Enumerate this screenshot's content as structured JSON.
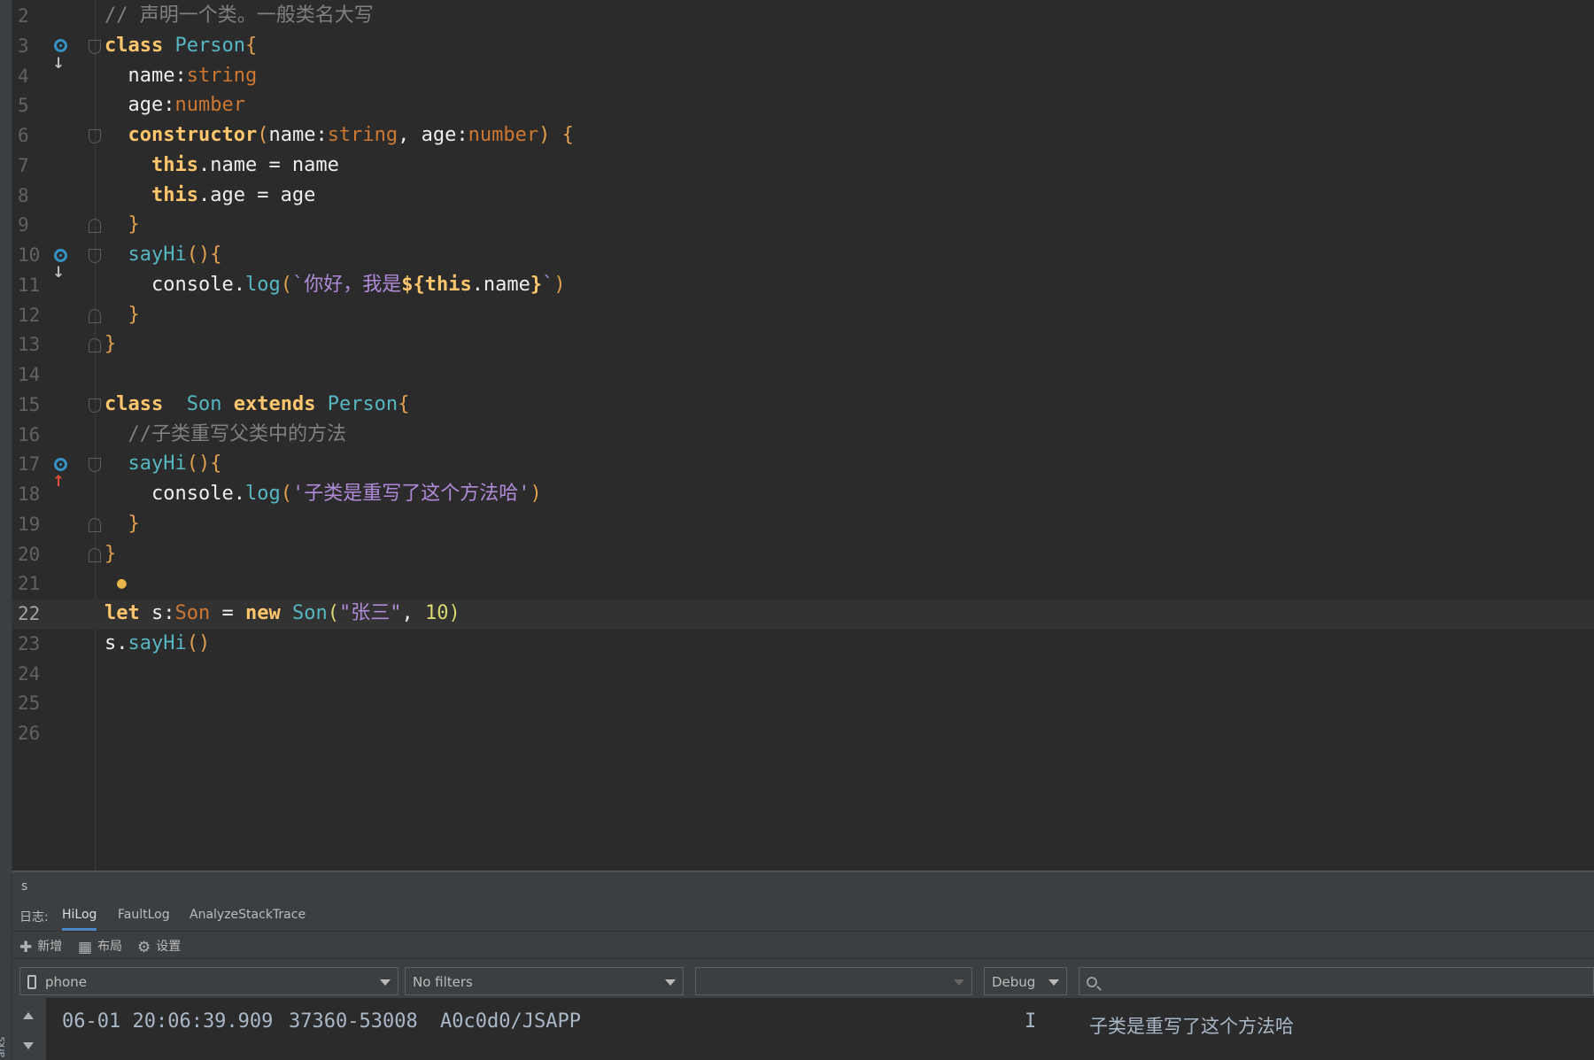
{
  "left_strip": {
    "label": "arks"
  },
  "editor": {
    "lines": [
      {
        "n": "2",
        "tokens": [
          {
            "t": "// 声明一个类。一般类名大写",
            "c": "cm"
          }
        ]
      },
      {
        "n": "3",
        "marker": "down",
        "fold": "open",
        "tokens": [
          {
            "t": "class",
            "c": "kwb"
          },
          {
            "t": " ",
            "c": "id"
          },
          {
            "t": "Person",
            "c": "cls"
          },
          {
            "t": "{",
            "c": "br"
          }
        ]
      },
      {
        "n": "4",
        "tokens": [
          {
            "t": "  name",
            "c": "id"
          },
          {
            "t": ":",
            "c": "id"
          },
          {
            "t": "string",
            "c": "typ"
          }
        ]
      },
      {
        "n": "5",
        "tokens": [
          {
            "t": "  age",
            "c": "id"
          },
          {
            "t": ":",
            "c": "id"
          },
          {
            "t": "number",
            "c": "typ"
          }
        ]
      },
      {
        "n": "6",
        "fold": "open",
        "tokens": [
          {
            "t": "  ",
            "c": "id"
          },
          {
            "t": "constructor",
            "c": "ctor"
          },
          {
            "t": "(",
            "c": "br"
          },
          {
            "t": "name",
            "c": "id"
          },
          {
            "t": ":",
            "c": "id"
          },
          {
            "t": "string",
            "c": "typ"
          },
          {
            "t": ", ",
            "c": "id"
          },
          {
            "t": "age",
            "c": "id"
          },
          {
            "t": ":",
            "c": "id"
          },
          {
            "t": "number",
            "c": "typ"
          },
          {
            "t": ")",
            "c": "br"
          },
          {
            "t": " ",
            "c": "id"
          },
          {
            "t": "{",
            "c": "br"
          }
        ]
      },
      {
        "n": "7",
        "tokens": [
          {
            "t": "    ",
            "c": "id"
          },
          {
            "t": "this",
            "c": "this"
          },
          {
            "t": ".name = name",
            "c": "id"
          }
        ]
      },
      {
        "n": "8",
        "tokens": [
          {
            "t": "    ",
            "c": "id"
          },
          {
            "t": "this",
            "c": "this"
          },
          {
            "t": ".age = age",
            "c": "id"
          }
        ]
      },
      {
        "n": "9",
        "fold": "close",
        "tokens": [
          {
            "t": "  ",
            "c": "id"
          },
          {
            "t": "}",
            "c": "br"
          }
        ]
      },
      {
        "n": "10",
        "marker": "down",
        "fold": "open",
        "tokens": [
          {
            "t": "  ",
            "c": "id"
          },
          {
            "t": "sayHi",
            "c": "fn"
          },
          {
            "t": "(){",
            "c": "br"
          }
        ]
      },
      {
        "n": "11",
        "tokens": [
          {
            "t": "    console.",
            "c": "id"
          },
          {
            "t": "log",
            "c": "fn"
          },
          {
            "t": "(",
            "c": "br"
          },
          {
            "t": "`你好，我是",
            "c": "str"
          },
          {
            "t": "${",
            "c": "tpl"
          },
          {
            "t": "this",
            "c": "this"
          },
          {
            "t": ".name",
            "c": "id"
          },
          {
            "t": "}",
            "c": "tpl"
          },
          {
            "t": "`",
            "c": "str"
          },
          {
            "t": ")",
            "c": "br"
          }
        ]
      },
      {
        "n": "12",
        "fold": "close",
        "tokens": [
          {
            "t": "  ",
            "c": "id"
          },
          {
            "t": "}",
            "c": "br"
          }
        ]
      },
      {
        "n": "13",
        "fold": "close",
        "tokens": [
          {
            "t": "}",
            "c": "br"
          }
        ]
      },
      {
        "n": "14",
        "tokens": []
      },
      {
        "n": "15",
        "fold": "open",
        "tokens": [
          {
            "t": "class",
            "c": "kwb"
          },
          {
            "t": "  ",
            "c": "id"
          },
          {
            "t": "Son",
            "c": "cls"
          },
          {
            "t": " ",
            "c": "id"
          },
          {
            "t": "extends",
            "c": "kwb"
          },
          {
            "t": " ",
            "c": "id"
          },
          {
            "t": "Person",
            "c": "cls"
          },
          {
            "t": "{",
            "c": "br"
          }
        ]
      },
      {
        "n": "16",
        "tokens": [
          {
            "t": "  //子类重写父类中的方法",
            "c": "cm"
          }
        ]
      },
      {
        "n": "17",
        "marker": "up",
        "fold": "open",
        "tokens": [
          {
            "t": "  ",
            "c": "id"
          },
          {
            "t": "sayHi",
            "c": "fn"
          },
          {
            "t": "(){",
            "c": "br"
          }
        ]
      },
      {
        "n": "18",
        "tokens": [
          {
            "t": "    console.",
            "c": "id"
          },
          {
            "t": "log",
            "c": "fn"
          },
          {
            "t": "(",
            "c": "br"
          },
          {
            "t": "'子类是重写了这个方法哈'",
            "c": "str"
          },
          {
            "t": ")",
            "c": "br"
          }
        ]
      },
      {
        "n": "19",
        "fold": "close",
        "tokens": [
          {
            "t": "  ",
            "c": "id"
          },
          {
            "t": "}",
            "c": "br"
          }
        ]
      },
      {
        "n": "20",
        "fold": "close",
        "tokens": [
          {
            "t": "}",
            "c": "br"
          }
        ]
      },
      {
        "n": "21",
        "bulb": true,
        "tokens": []
      },
      {
        "n": "22",
        "current": true,
        "tokens": [
          {
            "t": "let",
            "c": "kwb"
          },
          {
            "t": " s:",
            "c": "id"
          },
          {
            "t": "Son",
            "c": "typ"
          },
          {
            "t": " = ",
            "c": "id"
          },
          {
            "t": "new",
            "c": "kwb"
          },
          {
            "t": " ",
            "c": "id"
          },
          {
            "t": "Son",
            "c": "cls"
          },
          {
            "t": "(",
            "c": "num"
          },
          {
            "t": "\"张三\"",
            "c": "str"
          },
          {
            "t": ", ",
            "c": "id"
          },
          {
            "t": "10",
            "c": "num"
          },
          {
            "t": ")",
            "c": "num"
          }
        ]
      },
      {
        "n": "23",
        "tokens": [
          {
            "t": "s.",
            "c": "id"
          },
          {
            "t": "sayHi",
            "c": "fn"
          },
          {
            "t": "()",
            "c": "br"
          }
        ]
      },
      {
        "n": "24",
        "tokens": []
      },
      {
        "n": "25",
        "tokens": []
      },
      {
        "n": "26",
        "tokens": []
      }
    ]
  },
  "tool_window": {
    "title": "s",
    "log_label": "日志:",
    "tabs": [
      "HiLog",
      "FaultLog",
      "AnalyzeStackTrace"
    ],
    "active_tab": "HiLog",
    "actions": {
      "add": "新增",
      "layout": "布局",
      "settings": "设置"
    },
    "device": "phone",
    "filter": "No filters",
    "process": "",
    "level": "Debug",
    "search_placeholder": ""
  },
  "log": {
    "time": "06-01 20:06:39.909",
    "pid": "37360-53008",
    "tag": "A0c0d0/JSAPP",
    "level": "I",
    "message": "子类是重写了这个方法哈"
  },
  "colors": {
    "editor_bg": "#2b2b2b",
    "panel_bg": "#3c3f41",
    "accent": "#4a88c7",
    "override_marker": "#3592c4",
    "arrow_down": "#c0c0c0",
    "arrow_up": "#e0503a"
  }
}
